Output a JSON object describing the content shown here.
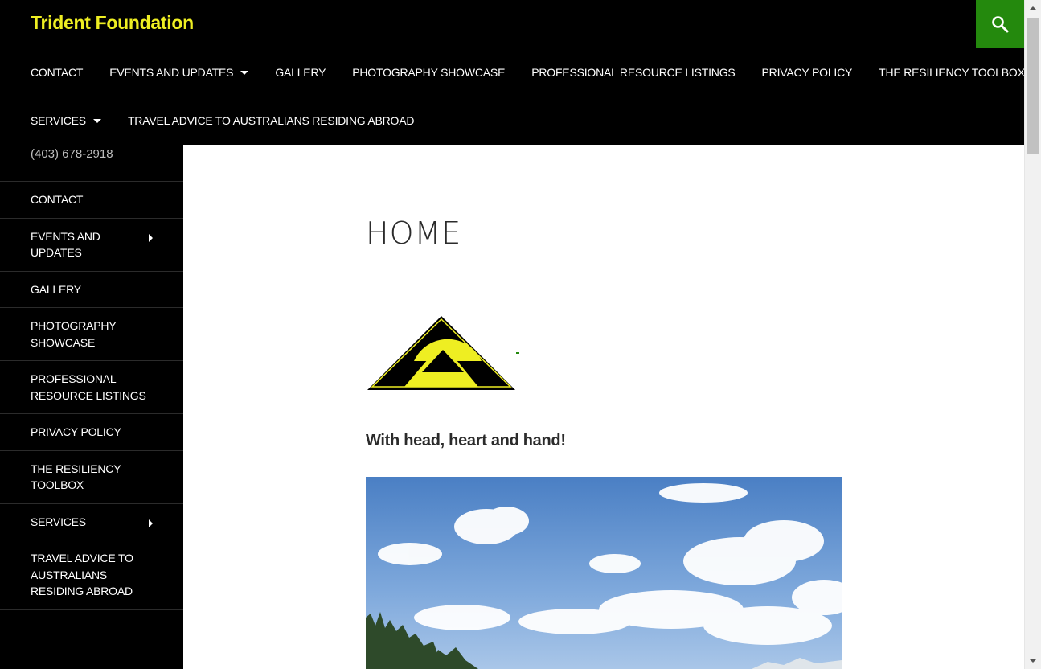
{
  "site": {
    "title": "Trident Foundation"
  },
  "icons": {
    "search": "search-icon"
  },
  "colors": {
    "accent": "#24890d",
    "title": "#eeee22",
    "background": "#000000"
  },
  "primary_nav": {
    "row1": [
      {
        "label": "CONTACT"
      },
      {
        "label": "EVENTS AND UPDATES",
        "has_submenu": true
      },
      {
        "label": "GALLERY"
      },
      {
        "label": "PHOTOGRAPHY SHOWCASE"
      },
      {
        "label": "PROFESSIONAL RESOURCE LISTINGS"
      },
      {
        "label": "PRIVACY POLICY"
      },
      {
        "label": "THE RESILIENCY TOOLBOX"
      }
    ],
    "row2": [
      {
        "label": "SERVICES",
        "has_submenu": true
      },
      {
        "label": "TRAVEL ADVICE TO AUSTRALIANS RESIDING ABROAD"
      }
    ]
  },
  "sidebar": {
    "phone": "(403) 678-2918",
    "items": [
      {
        "label": "CONTACT"
      },
      {
        "label": "EVENTS AND UPDATES",
        "has_submenu": true
      },
      {
        "label": "GALLERY"
      },
      {
        "label": "PHOTOGRAPHY SHOWCASE"
      },
      {
        "label": "PROFESSIONAL RESOURCE LISTINGS"
      },
      {
        "label": "PRIVACY POLICY"
      },
      {
        "label": "THE RESILIENCY TOOLBOX"
      },
      {
        "label": "SERVICES",
        "has_submenu": true
      },
      {
        "label": "TRAVEL ADVICE TO AUSTRALIANS RESIDING ABROAD"
      }
    ]
  },
  "main": {
    "page_title": "HOME",
    "tagline": "With head, heart and hand!"
  }
}
